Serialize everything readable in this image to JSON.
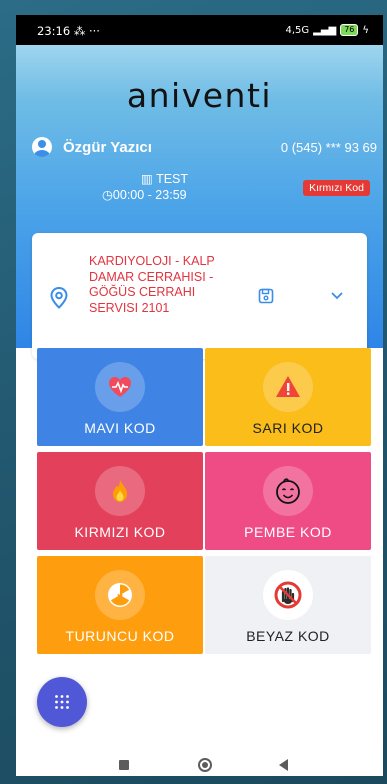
{
  "status_bar": {
    "time": "23:16",
    "extra": "⁂ ···",
    "network": "4,5G",
    "battery": "76"
  },
  "app": {
    "logo": "aniventi"
  },
  "user": {
    "name": "Özgür Yazıcı",
    "phone": "0 (545) *** 93 69"
  },
  "location": {
    "name": "TEST",
    "hours": "00:00 - 23:59",
    "code_badge": "Kırmızı Kod"
  },
  "department": {
    "name": "KARDIYOLOJI - KALP DAMAR CERRAHISI - GÖĞÜS CERRAHI SERVISI 2101"
  },
  "codes": [
    {
      "label": "MAVI KOD",
      "color": "#3f84e5",
      "icon": "heart-pulse-icon"
    },
    {
      "label": "SARI KOD",
      "color": "#fbbd1a",
      "icon": "warning-icon"
    },
    {
      "label": "KIRMIZI KOD",
      "color": "#e3405b",
      "icon": "fire-icon"
    },
    {
      "label": "PEMBE KOD",
      "color": "#ef4c86",
      "icon": "baby-face-icon"
    },
    {
      "label": "TURUNCU KOD",
      "color": "#fe9e0f",
      "icon": "radiation-icon"
    },
    {
      "label": "BEYAZ KOD",
      "color": "#f0f1f5",
      "icon": "stop-hand-icon"
    }
  ],
  "colors": {
    "accent": "#3f84e5",
    "fab": "#5158d8",
    "department_text": "#e0353f"
  }
}
